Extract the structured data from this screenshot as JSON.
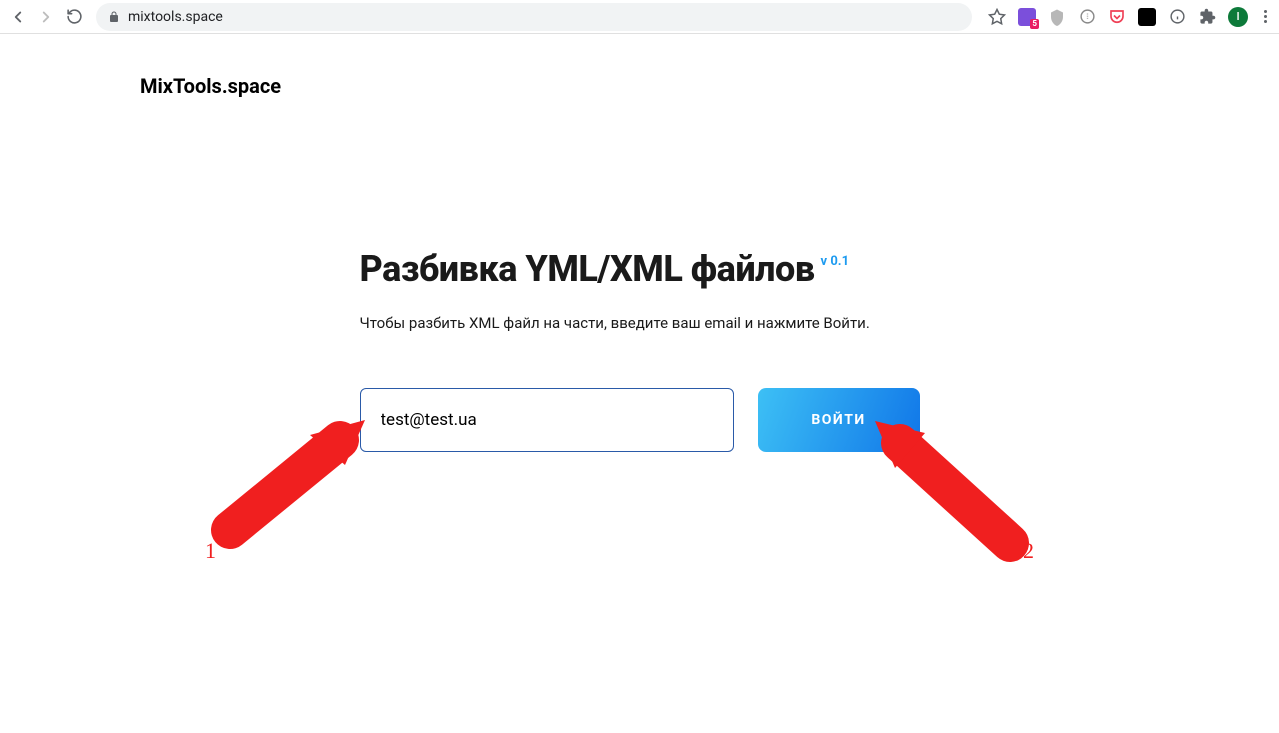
{
  "browser": {
    "url": "mixtools.space",
    "extension_badge": "5",
    "avatar_initial": "I"
  },
  "page": {
    "logo": "MixTools.space",
    "title": "Разбивка YML/XML файлов",
    "version": "v 0.1",
    "subtitle": "Чтобы разбить XML файл на части, введите ваш email и нажмите Войти.",
    "email_value": "test@test.ua",
    "login_button": "ВОЙТИ"
  },
  "annotations": {
    "label1": "1",
    "label2": "2"
  }
}
